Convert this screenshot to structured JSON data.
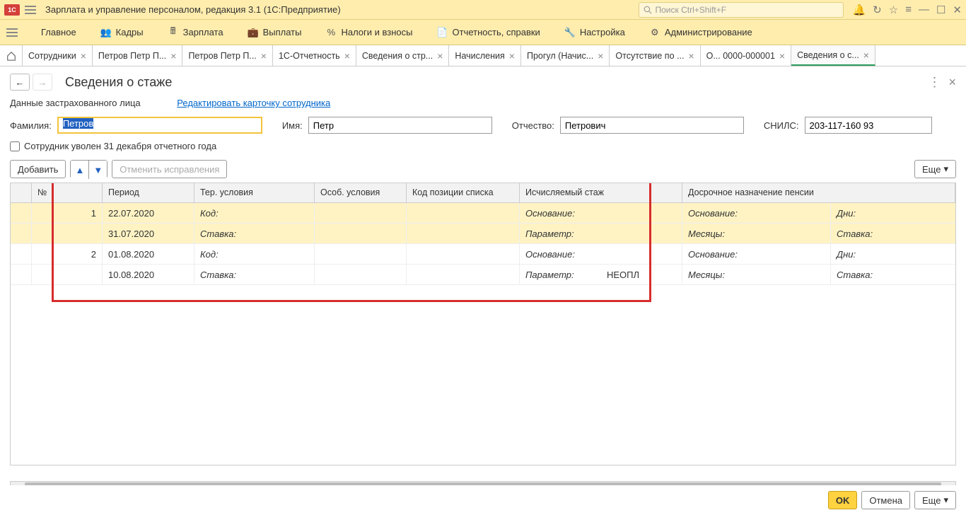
{
  "app": {
    "title": "Зарплата и управление персоналом, редакция 3.1  (1С:Предприятие)",
    "search_placeholder": "Поиск Ctrl+Shift+F"
  },
  "mainmenu": {
    "items": [
      {
        "label": "Главное"
      },
      {
        "label": "Кадры"
      },
      {
        "label": "Зарплата"
      },
      {
        "label": "Выплаты"
      },
      {
        "label": "Налоги и взносы"
      },
      {
        "label": "Отчетность, справки"
      },
      {
        "label": "Настройка"
      },
      {
        "label": "Администрирование"
      }
    ]
  },
  "tabs": [
    {
      "label": "Сотрудники"
    },
    {
      "label": "Петров Петр П..."
    },
    {
      "label": "Петров Петр П..."
    },
    {
      "label": "1С-Отчетность"
    },
    {
      "label": "Сведения о стр..."
    },
    {
      "label": "Начисления"
    },
    {
      "label": "Прогул (Начис..."
    },
    {
      "label": "Отсутствие по ..."
    },
    {
      "label": "О... 0000-000001"
    },
    {
      "label": "Сведения о с..."
    }
  ],
  "page": {
    "title": "Сведения о стаже",
    "insured_label": "Данные застрахованного лица",
    "edit_link": "Редактировать карточку сотрудника",
    "lastname_label": "Фамилия:",
    "lastname_value": "Петров",
    "firstname_label": "Имя:",
    "firstname_value": "Петр",
    "patronymic_label": "Отчество:",
    "patronymic_value": "Петрович",
    "snils_label": "СНИЛС:",
    "snils_value": "203-117-160 93",
    "fired_checkbox_label": "Сотрудник уволен 31 декабря отчетного года"
  },
  "toolbar": {
    "add": "Добавить",
    "cancel_fix": "Отменить исправления",
    "more": "Еще"
  },
  "grid": {
    "headers": {
      "num": "№",
      "period": "Период",
      "ter": "Тер. условия",
      "spec": "Особ. условия",
      "pos_code": "Код позиции списка",
      "calc": "Исчисляемый стаж",
      "pension": "Досрочное назначение пенсии"
    },
    "rows": [
      {
        "num": "1",
        "date1": "22.07.2020",
        "date2": "31.07.2020",
        "ter1": "Код:",
        "ter2": "Ставка:",
        "calc1": "Основание:",
        "calc2": "Параметр:",
        "calc2_val": "",
        "pens1": "Основание:",
        "pens2": "Месяцы:",
        "dni": "Дни:",
        "stavka": "Ставка:",
        "selected": true
      },
      {
        "num": "2",
        "date1": "01.08.2020",
        "date2": "10.08.2020",
        "ter1": "Код:",
        "ter2": "Ставка:",
        "calc1": "Основание:",
        "calc2": "Параметр:",
        "calc2_val": "НЕОПЛ",
        "pens1": "Основание:",
        "pens2": "Месяцы:",
        "dni": "Дни:",
        "stavka": "Ставка:",
        "selected": false
      }
    ]
  },
  "footer": {
    "ok": "OK",
    "cancel": "Отмена",
    "more": "Еще"
  }
}
